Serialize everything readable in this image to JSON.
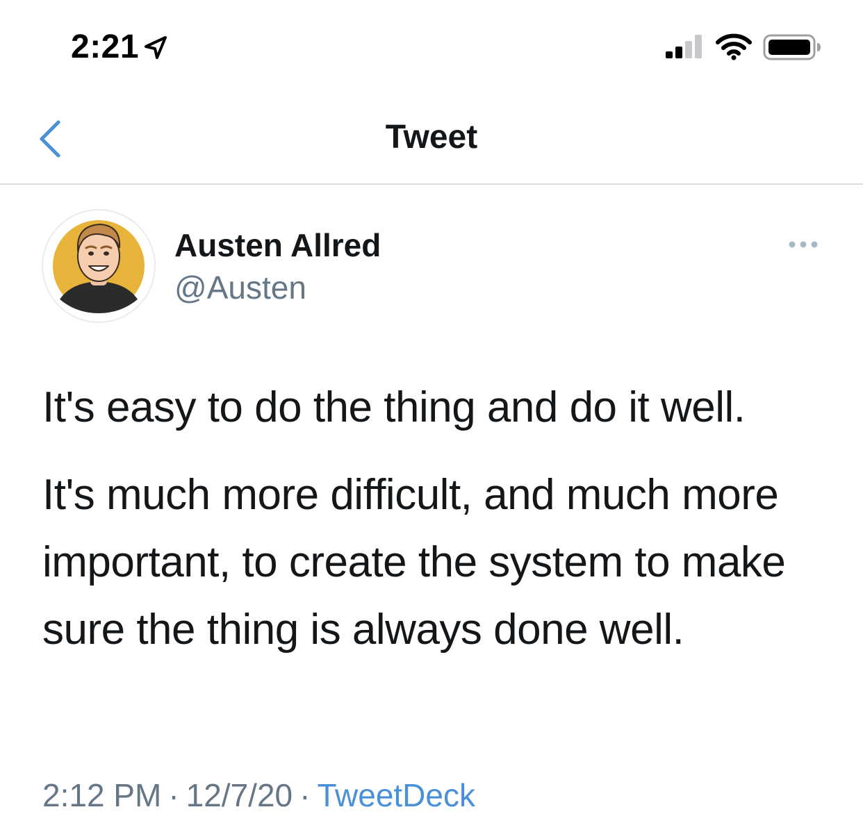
{
  "status_bar": {
    "time": "2:21",
    "icons": [
      "location-arrow-icon",
      "cellular-signal-icon",
      "wifi-icon",
      "battery-icon"
    ]
  },
  "nav": {
    "title": "Tweet",
    "back_icon": "chevron-left-icon"
  },
  "tweet": {
    "author_name": "Austen Allred",
    "author_handle": "@Austen",
    "more_icon": "ellipsis-icon",
    "paragraphs": [
      "It's easy to do the thing and do it well.",
      "It's much more difficult, and much more important, to create the system to make sure the thing is always done well."
    ],
    "time": "2:12 PM",
    "date": "12/7/20",
    "separator": "·",
    "source": "TweetDeck"
  },
  "colors": {
    "accent": "#4a90d9",
    "text_primary": "#14171a",
    "text_secondary": "#657786",
    "divider": "#d8dde1",
    "avatar_background": "#e8b33a"
  }
}
